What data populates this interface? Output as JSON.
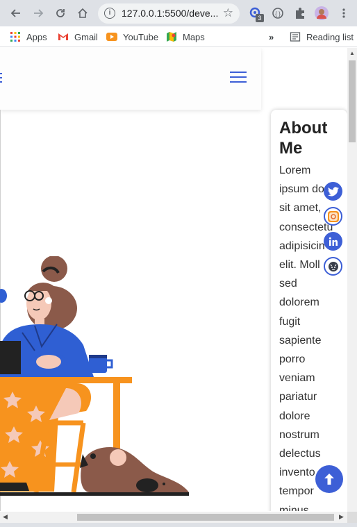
{
  "browser": {
    "url": "127.0.0.1:5500/deve...",
    "extension_badge": "3",
    "bookmarks": [
      {
        "label": "Apps",
        "icon": "apps-grid-icon"
      },
      {
        "label": "Gmail",
        "icon": "gmail-icon"
      },
      {
        "label": "YouTube",
        "icon": "youtube-icon"
      },
      {
        "label": "Maps",
        "icon": "maps-icon"
      }
    ],
    "more_bookmarks": "»",
    "reading_list": "Reading list"
  },
  "page": {
    "about_title": "About Me",
    "about_lines": [
      "Lorem",
      "ipsum do",
      "sit amet,",
      "consectetu",
      "adipisicin",
      "elit. Moll",
      "sed",
      "dolorem",
      "fugit",
      "sapiente",
      "porro",
      "veniam",
      "pariatur",
      "dolore",
      "nostrum",
      "delectus",
      "invento",
      "tempor",
      "minus"
    ],
    "social_links": [
      "twitter-icon",
      "instagram-icon",
      "linkedin-icon",
      "github-icon"
    ]
  },
  "colors": {
    "accent": "#3d5fd6",
    "illustration_orange": "#f7931e",
    "illustration_blue": "#2f5fd3",
    "illustration_brown": "#8b5a4a"
  }
}
